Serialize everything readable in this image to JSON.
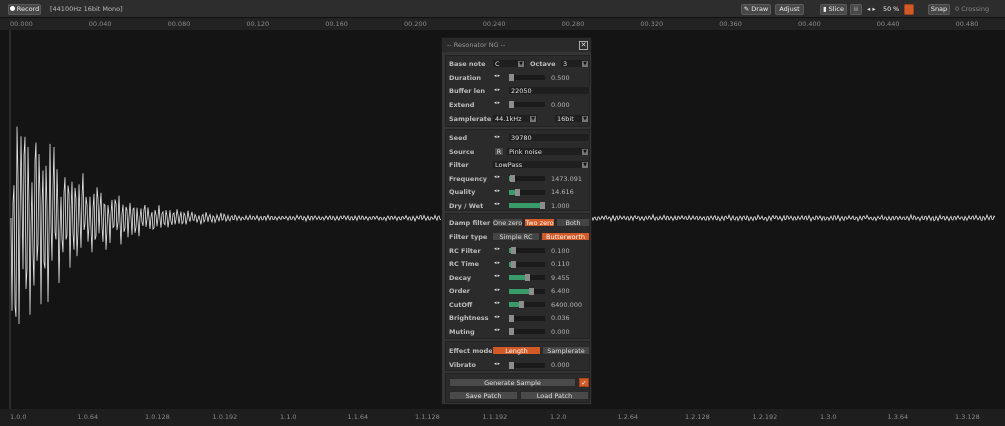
{
  "toolbar": {
    "record_label": "Record",
    "format_label": "[44100Hz 16bit Mono]",
    "draw_label": "Draw",
    "adjust_label": "Adjust",
    "slice_label": "Slice",
    "zoom_value": "50",
    "zoom_unit": "%",
    "snap_label": "Snap",
    "snap_mode": "0 Crossing",
    "accent": "#d35a26"
  },
  "time_ruler": [
    "00.000",
    "00.040",
    "00.080",
    "00.120",
    "00.160",
    "00.200",
    "00.240",
    "00.280",
    "00.320",
    "00.360",
    "00.400",
    "00.440",
    "00.480"
  ],
  "beat_ruler": [
    "1.0.0",
    "1.0.64",
    "1.0.128",
    "1.0.192",
    "1.1.0",
    "1.1.64",
    "1.1.128",
    "1.1.192",
    "1.2.0",
    "1.2.64",
    "1.2.128",
    "1.2.192",
    "1.3.0",
    "1.3.64",
    "1.3.128"
  ],
  "panel": {
    "title": "-- Resonator NG --",
    "base_note_label": "Base note",
    "base_note_value": "C",
    "octave_label": "Octave",
    "octave_value": "3",
    "duration_label": "Duration",
    "duration_value": "0.500",
    "duration_level": 0.05,
    "buffer_len_label": "Buffer len",
    "buffer_len_value": "22050",
    "extend_label": "Extend",
    "extend_value": "0.000",
    "extend_level": 0.0,
    "samplerate_label": "Samplerate",
    "samplerate_value": "44.1kHz",
    "bitdepth_value": "16bit",
    "seed_label": "Seed",
    "seed_value": "39780",
    "source_label": "Source",
    "source_r_label": "R",
    "source_value": "Pink noise",
    "filter_label": "Filter",
    "filter_value": "LowPass",
    "frequency_label": "Frequency",
    "frequency_value": "1473.091",
    "frequency_level": 0.07,
    "quality_label": "Quality",
    "quality_value": "14.616",
    "quality_level": 0.22,
    "drywet_label": "Dry / Wet",
    "drywet_value": "1.000",
    "drywet_level": 1.0,
    "damp_filter_label": "Damp filter",
    "damp_options": [
      "One zero",
      "Two zero",
      "Both"
    ],
    "damp_selected": 1,
    "filter_type_label": "Filter type",
    "filter_type_options": [
      "Simple RC",
      "Butterworth"
    ],
    "filter_type_selected": 1,
    "rc_filter_label": "RC Filter",
    "rc_filter_value": "0.100",
    "rc_filter_level": 0.1,
    "rc_time_label": "RC Time",
    "rc_time_value": "0.110",
    "rc_time_level": 0.11,
    "decay_label": "Decay",
    "decay_value": "9.455",
    "decay_level": 0.5,
    "order_label": "Order",
    "order_value": "6.400",
    "order_level": 0.62,
    "cutoff_label": "CutOff",
    "cutoff_value": "6400.000",
    "cutoff_level": 0.34,
    "brightness_label": "Brightness",
    "brightness_value": "0.036",
    "brightness_level": 0.04,
    "muting_label": "Muting",
    "muting_value": "0.000",
    "muting_level": 0.0,
    "effect_mode_label": "Effect mode",
    "effect_options": [
      "Length",
      "Samplerate"
    ],
    "effect_selected": 0,
    "vibrato_label": "Vibrato",
    "vibrato_value": "0.000",
    "vibrato_level": 0.0,
    "generate_label": "Generate Sample",
    "save_label": "Save Patch",
    "load_label": "Load Patch"
  }
}
